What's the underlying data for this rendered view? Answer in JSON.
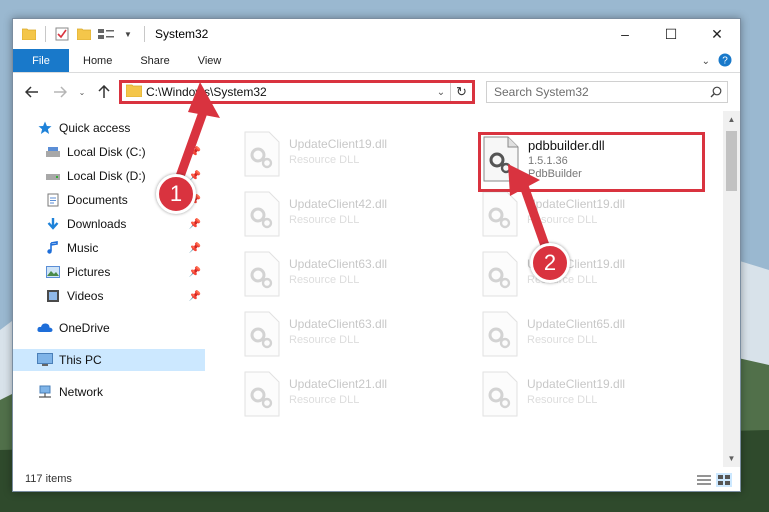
{
  "window": {
    "title": "System32",
    "controls": {
      "minimize": "–",
      "maximize": "☐",
      "close": "✕"
    }
  },
  "ribbon": {
    "tabs": [
      {
        "label": "File"
      },
      {
        "label": "Home"
      },
      {
        "label": "Share"
      },
      {
        "label": "View"
      }
    ]
  },
  "navbar": {
    "address": "C:\\Windows\\System32",
    "search_placeholder": "Search System32"
  },
  "sidebar": {
    "items": [
      {
        "label": "Quick access",
        "icon": "star-icon"
      },
      {
        "label": "Local Disk (C:)",
        "icon": "drive-icon",
        "pinned": true
      },
      {
        "label": "Local Disk (D:)",
        "icon": "drive-icon",
        "pinned": true
      },
      {
        "label": "Documents",
        "icon": "documents-icon",
        "pinned": true
      },
      {
        "label": "Downloads",
        "icon": "downloads-icon",
        "pinned": true
      },
      {
        "label": "Music",
        "icon": "music-icon",
        "pinned": true
      },
      {
        "label": "Pictures",
        "icon": "pictures-icon",
        "pinned": true
      },
      {
        "label": "Videos",
        "icon": "videos-icon",
        "pinned": true
      },
      {
        "label": "OneDrive",
        "icon": "cloud-icon"
      },
      {
        "label": "This PC",
        "icon": "pc-icon",
        "selected": true
      },
      {
        "label": "Network",
        "icon": "network-icon"
      }
    ]
  },
  "files": [
    {
      "name": "UpdateClient19.dll",
      "desc": "Resource DLL"
    },
    {
      "name": "pdbbuilder.dll",
      "version": "1.5.1.36",
      "desc": "PdbBuilder",
      "highlighted": true
    },
    {
      "name": "UpdateClient42.dll",
      "desc": "Resource DLL"
    },
    {
      "name": "UpdateClient19.dll",
      "desc": "Resource DLL"
    },
    {
      "name": "UpdateClient63.dll",
      "desc": "Resource DLL"
    },
    {
      "name": "UpdateClient19.dll",
      "desc": "Resource DLL"
    },
    {
      "name": "UpdateClient63.dll",
      "desc": "Resource DLL"
    },
    {
      "name": "UpdateClient65.dll",
      "desc": "Resource DLL"
    },
    {
      "name": "UpdateClient21.dll",
      "desc": "Resource DLL"
    },
    {
      "name": "UpdateClient19.dll",
      "desc": "Resource DLL"
    }
  ],
  "status": {
    "item_count": "117 items"
  },
  "annotations": [
    {
      "label": "1"
    },
    {
      "label": "2"
    }
  ],
  "colors": {
    "accent": "#1979ca",
    "annotation_red": "#d9333f",
    "selected_bg": "#cce8ff"
  }
}
